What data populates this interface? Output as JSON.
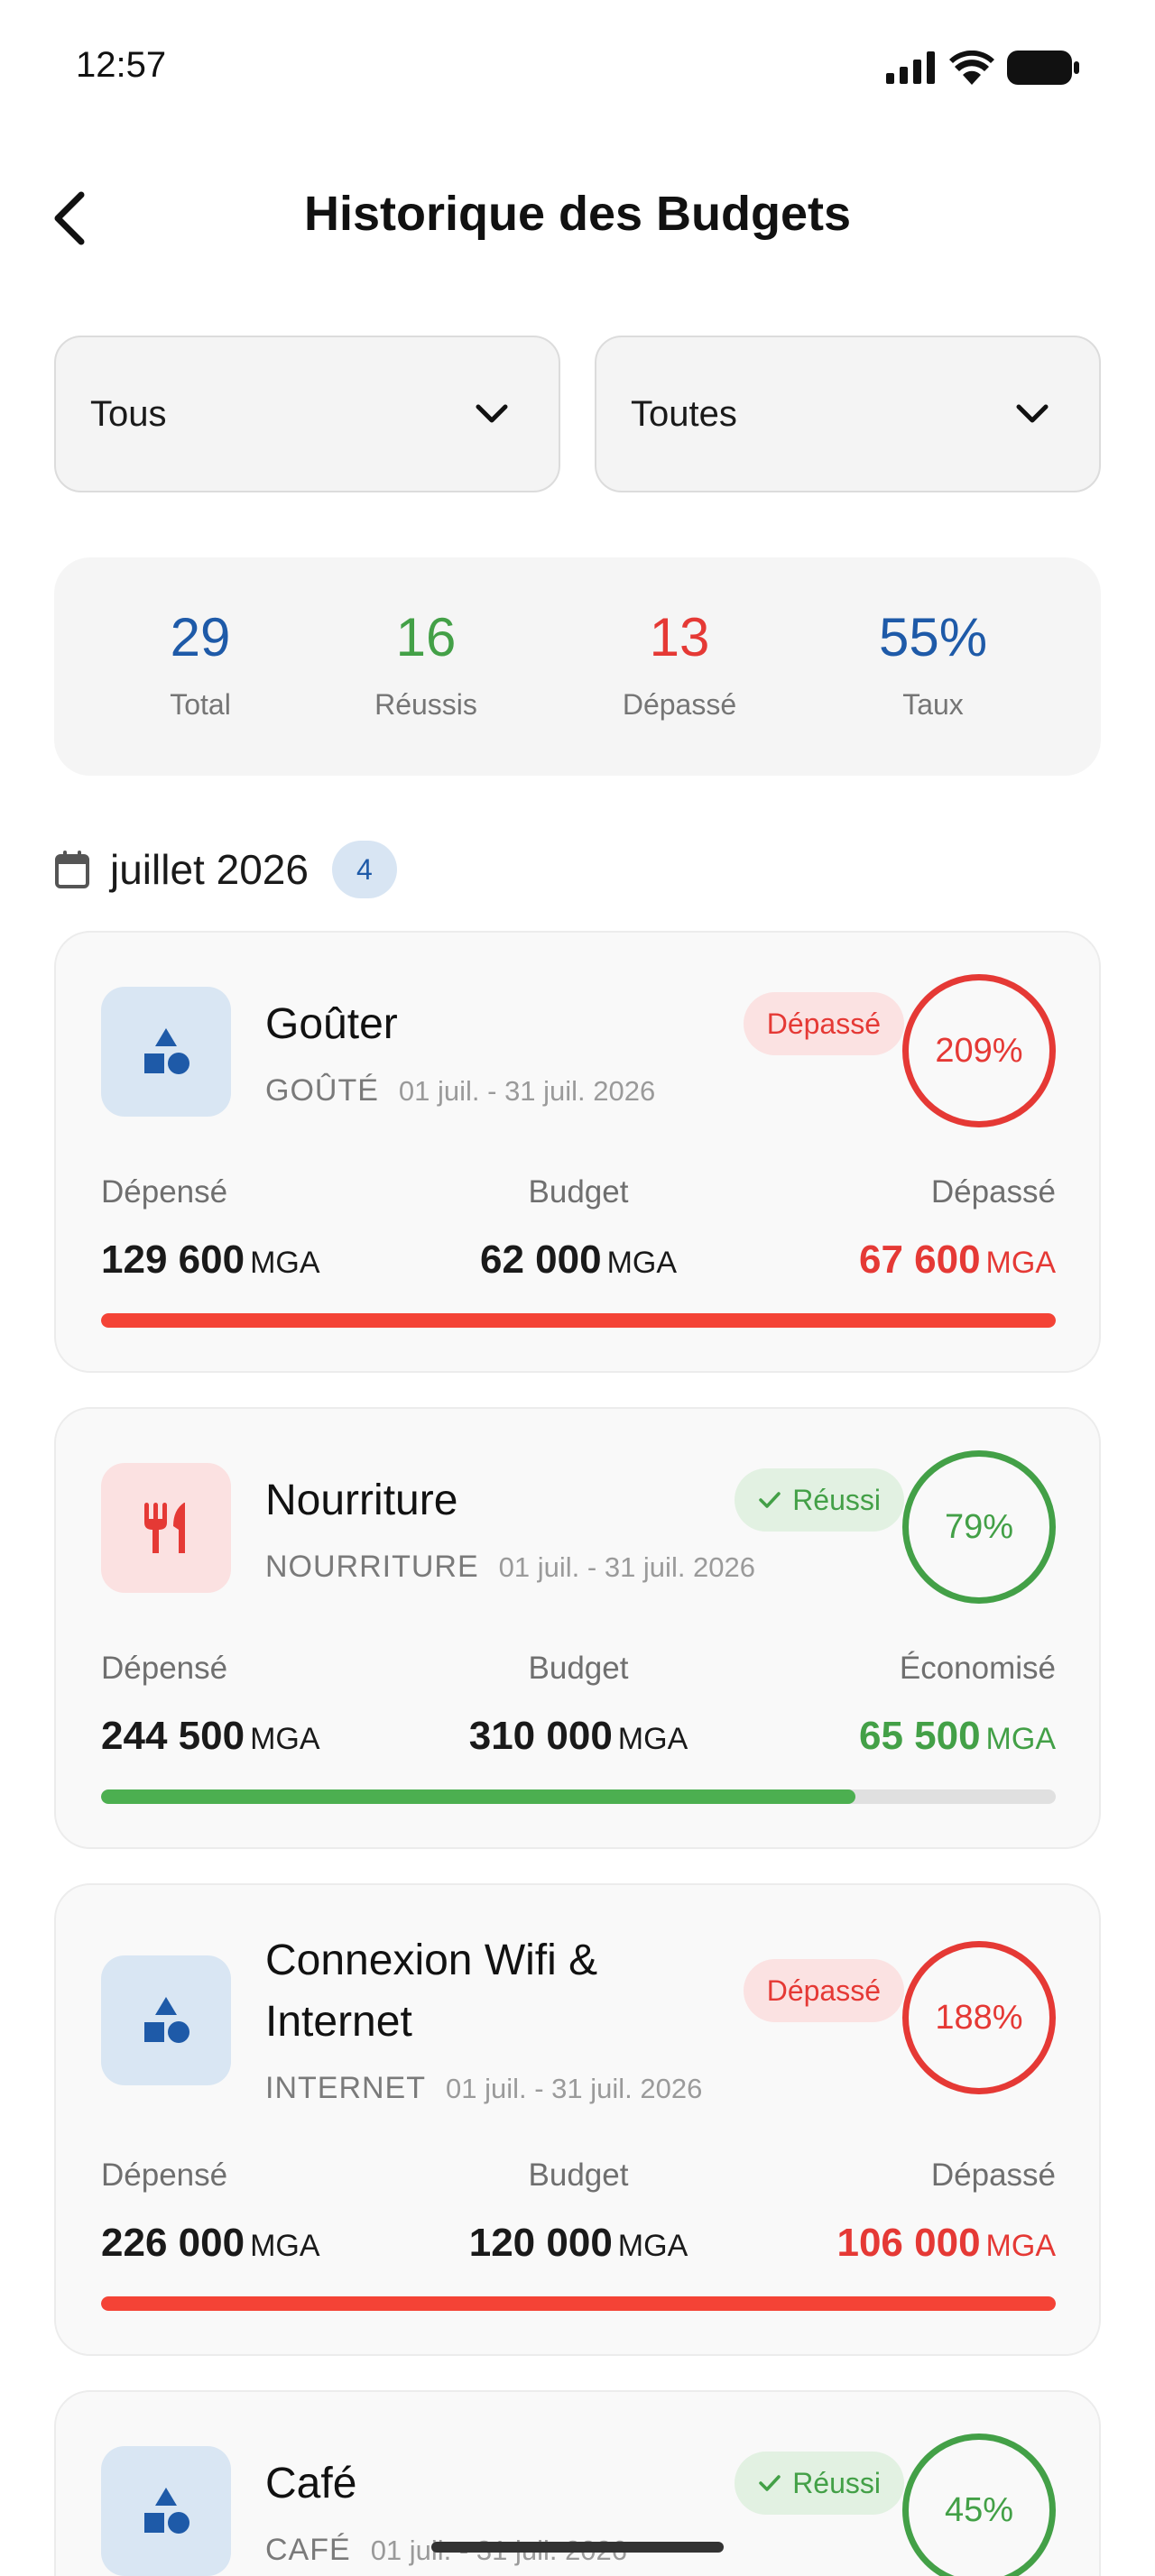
{
  "status_bar": {
    "time": "12:57"
  },
  "header": {
    "title": "Historique des Budgets"
  },
  "filters": [
    {
      "value": "Tous"
    },
    {
      "value": "Toutes"
    }
  ],
  "stats": {
    "total": {
      "value": "29",
      "label": "Total"
    },
    "success": {
      "value": "16",
      "label": "Réussis"
    },
    "exceeded": {
      "value": "13",
      "label": "Dépassé"
    },
    "rate": {
      "value": "55%",
      "label": "Taux"
    }
  },
  "month": {
    "label": "juillet 2026",
    "count": "4"
  },
  "budgets": [
    {
      "name": "Goûter",
      "code": "GOÛTÉ",
      "period": "01 juil. - 31 juil. 2026",
      "icon": "shapes-icon",
      "status": "Dépassé",
      "percent": "209%",
      "progress": 1.0,
      "spent_label": "Dépensé",
      "spent": "129 600",
      "budget_label": "Budget",
      "budget": "62 000",
      "diff_label": "Dépassé",
      "diff": "67 600",
      "currency": "MGA"
    },
    {
      "name": "Nourriture",
      "code": "NOURRITURE",
      "period": "01 juil. - 31 juil. 2026",
      "icon": "utensils-icon",
      "status": "Réussi",
      "percent": "79%",
      "progress": 0.79,
      "spent_label": "Dépensé",
      "spent": "244 500",
      "budget_label": "Budget",
      "budget": "310 000",
      "diff_label": "Économisé",
      "diff": "65 500",
      "currency": "MGA"
    },
    {
      "name": "Connexion Wifi & Internet",
      "code": "INTERNET",
      "period": "01 juil. - 31 juil. 2026",
      "icon": "shapes-icon",
      "status": "Dépassé",
      "percent": "188%",
      "progress": 1.0,
      "spent_label": "Dépensé",
      "spent": "226 000",
      "budget_label": "Budget",
      "budget": "120 000",
      "diff_label": "Dépassé",
      "diff": "106 000",
      "currency": "MGA"
    },
    {
      "name": "Café",
      "code": "CAFÉ",
      "period": "01 juil. - 31 juil. 2026",
      "icon": "shapes-icon",
      "status": "Réussi",
      "percent": "45%"
    }
  ],
  "colors": {
    "primary_blue": "#1e5aa8",
    "success_green": "#43a047",
    "danger_red": "#e53935"
  }
}
